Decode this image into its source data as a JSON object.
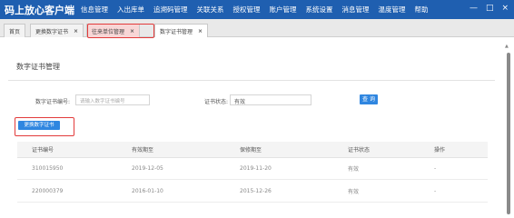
{
  "app": {
    "title": "码上放心客户端"
  },
  "menu": [
    "信息管理",
    "入出库单",
    "追溯码管理",
    "关联关系",
    "授权管理",
    "账户管理",
    "系统设置",
    "消息管理",
    "温度管理",
    "帮助"
  ],
  "window_controls": {
    "minimize": "—",
    "maximize": "□",
    "close": "×"
  },
  "tabs": [
    {
      "label": "首页",
      "closable": false
    },
    {
      "label": "更换数字证书",
      "closable": true
    },
    {
      "label": "往来单位管理",
      "closable": true
    },
    {
      "label": "数字证书管理",
      "closable": true
    }
  ],
  "tab_close_glyph": "×",
  "page": {
    "title": "数字证书管理"
  },
  "filters": {
    "cert_no_label": "数字证书编号:",
    "cert_no_placeholder": "请输入数字证书编号",
    "status_label": "证书状态:",
    "status_value": "有效",
    "search_button": "查 询"
  },
  "actions": {
    "replace_button": "更换数字证书"
  },
  "table": {
    "headers": [
      "证书编号",
      "有效期至",
      "保修期至",
      "证书状态",
      "操作"
    ],
    "rows": [
      [
        "310015950",
        "2019-12-05",
        "2019-11-20",
        "有效",
        "-"
      ],
      [
        "220000379",
        "2016-01-10",
        "2015-12-26",
        "有效",
        "-"
      ]
    ]
  },
  "colors": {
    "topbar": "#1f5fb0",
    "primary_button": "#2f86e0",
    "highlight_border": "#e23b3b"
  }
}
